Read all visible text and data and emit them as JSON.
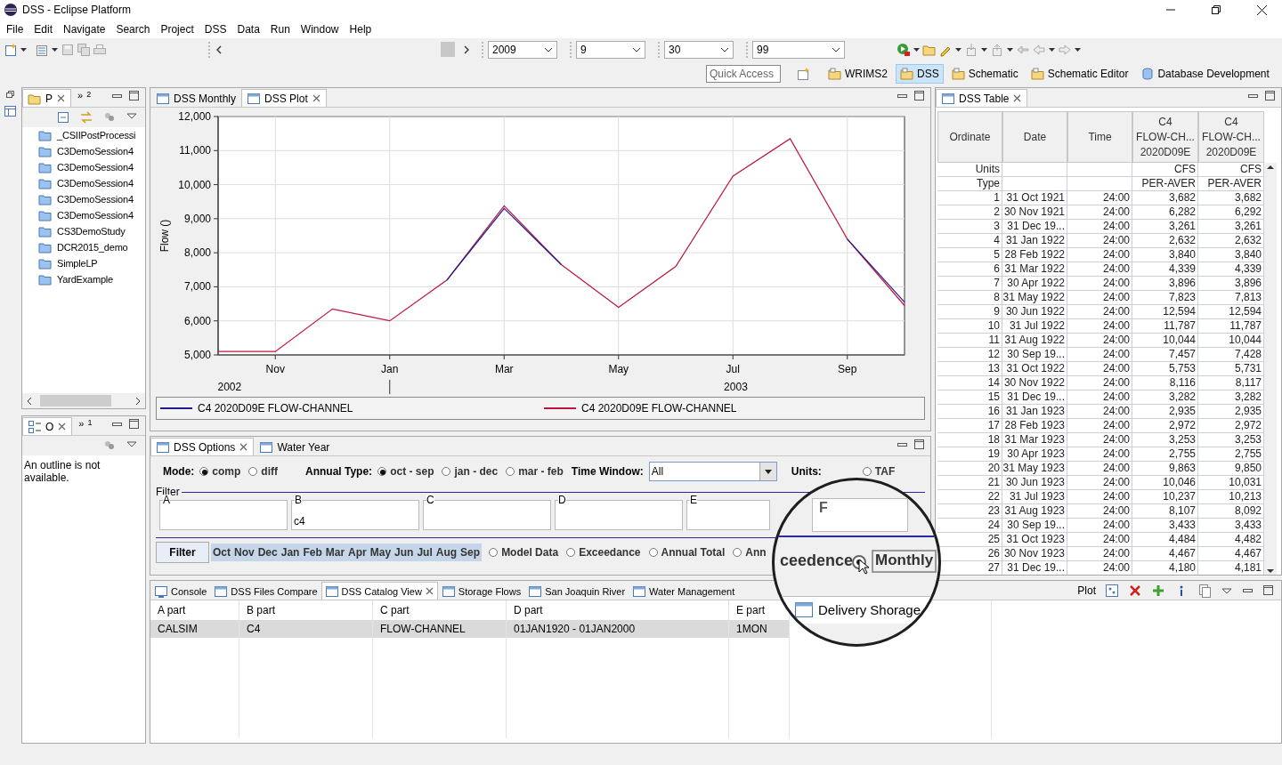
{
  "window": {
    "title": "DSS - Eclipse Platform"
  },
  "menu": [
    "File",
    "Edit",
    "Navigate",
    "Search",
    "Project",
    "DSS",
    "Data",
    "Run",
    "Window",
    "Help"
  ],
  "toolbar": {
    "combos": [
      "2009",
      "9",
      "30",
      "99"
    ]
  },
  "quick_access": {
    "placeholder": "Quick Access"
  },
  "perspectives": [
    {
      "label": "WRIMS2",
      "selected": false,
      "kind": "folder"
    },
    {
      "label": "DSS",
      "selected": true,
      "kind": "folder"
    },
    {
      "label": "Schematic",
      "selected": false,
      "kind": "folder"
    },
    {
      "label": "Schematic Editor",
      "selected": false,
      "kind": "folder"
    },
    {
      "label": "Database Development",
      "selected": false,
      "kind": "database"
    }
  ],
  "project_explorer": {
    "tab": "P",
    "overflow_symbol": "»",
    "overflow_count": "2",
    "items": [
      "_CSIIPostProcessi",
      "C3DemoSession4",
      "C3DemoSession4",
      "C3DemoSession4",
      "C3DemoSession4",
      "C3DemoSession4",
      "CS3DemoStudy",
      "DCR2015_demo",
      "SimpleLP",
      "YardExample"
    ]
  },
  "outline": {
    "tab": "O",
    "overflow_symbol": "»",
    "overflow_count": "1",
    "message": "An outline is not available."
  },
  "editor": {
    "tabs": [
      {
        "label": "DSS Monthly",
        "selected": false
      },
      {
        "label": "DSS Plot",
        "selected": true
      }
    ],
    "plot": {
      "year_labels": [
        "2002",
        "2003"
      ],
      "chart_data": {
        "type": "line",
        "ylabel": "Flow ()",
        "grid": true,
        "categories": [
          null,
          "Nov",
          null,
          "Jan",
          null,
          "Mar",
          null,
          "May",
          null,
          "Jul",
          null,
          "Sep",
          null
        ],
        "ylim": [
          5000,
          12000
        ],
        "yticks": [
          {
            "value": 5000,
            "label": "5,000"
          },
          {
            "value": 6000,
            "label": "6,000"
          },
          {
            "value": 7000,
            "label": "7,000"
          },
          {
            "value": 8000,
            "label": "8,000"
          },
          {
            "value": 9000,
            "label": "9,000"
          },
          {
            "value": 10000,
            "label": "10,000"
          },
          {
            "value": 11000,
            "label": "11,000"
          },
          {
            "value": 12000,
            "label": "12,000"
          }
        ],
        "series": [
          {
            "name": "C4 2020D09E FLOW-CHANNEL",
            "color": "#1c1c8c",
            "values": [
              null,
              null,
              null,
              null,
              7200,
              9300,
              7650,
              null,
              null,
              null,
              null,
              8400,
              6550
            ]
          },
          {
            "name": "C4 2020D09E FLOW-CHANNEL",
            "color": "#c0143c",
            "values": [
              5100,
              5100,
              6350,
              6000,
              7200,
              9380,
              7650,
              6400,
              7600,
              10250,
              11350,
              8400,
              6450
            ]
          }
        ]
      }
    }
  },
  "options": {
    "tabs": [
      {
        "label": "DSS Options",
        "selected": true
      },
      {
        "label": "Water Year",
        "selected": false
      }
    ],
    "mode_label": "Mode:",
    "mode": [
      {
        "label": "comp",
        "selected": true
      },
      {
        "label": "diff",
        "selected": false
      }
    ],
    "annual_type_label": "Annual Type:",
    "annual_type": [
      {
        "label": "oct - sep",
        "selected": true
      },
      {
        "label": "jan - dec",
        "selected": false
      },
      {
        "label": "mar - feb",
        "selected": false
      }
    ],
    "time_window_label": "Time Window:",
    "time_window": "All",
    "units_label": "Units:",
    "units": [
      {
        "label": "TAF",
        "selected": false
      }
    ],
    "filter_title": "Filter",
    "filter_fields": [
      {
        "label": "A"
      },
      {
        "label": "B",
        "value": "c4"
      },
      {
        "label": "C"
      },
      {
        "label": "D"
      },
      {
        "label": "E"
      }
    ],
    "filter_button": "Filter",
    "months": [
      {
        "label": "Oct",
        "selected": true
      },
      {
        "label": "Nov",
        "selected": true
      },
      {
        "label": "Dec",
        "selected": true
      },
      {
        "label": "Jan",
        "selected": true
      },
      {
        "label": "Feb",
        "selected": true
      },
      {
        "label": "Mar",
        "selected": true
      },
      {
        "label": "Apr",
        "selected": true
      },
      {
        "label": "May",
        "selected": true
      },
      {
        "label": "Jun",
        "selected": true
      },
      {
        "label": "Jul",
        "selected": true
      },
      {
        "label": "Aug",
        "selected": true
      },
      {
        "label": "Sep",
        "selected": true
      }
    ],
    "views": [
      {
        "label": "Model Data",
        "selected": false
      },
      {
        "label": "Exceedance",
        "selected": false
      },
      {
        "label": "Annual Total",
        "selected": false
      },
      {
        "label": "Ann",
        "selected": false
      }
    ]
  },
  "magnifier": {
    "field_label": "F",
    "view_text": "ceedence",
    "view_option": {
      "label": "Monthly",
      "selected": true
    },
    "tab": "Delivery Shorage"
  },
  "catalog": {
    "tabs": [
      {
        "label": "Console",
        "selected": false,
        "kind": "console"
      },
      {
        "label": "DSS Files Compare",
        "selected": false,
        "kind": "view"
      },
      {
        "label": "DSS Catalog View",
        "selected": true,
        "kind": "view"
      },
      {
        "label": "Storage Flows",
        "selected": false,
        "kind": "view"
      },
      {
        "label": "San Joaquin River",
        "selected": false,
        "kind": "view"
      },
      {
        "label": "Water Management",
        "selected": false,
        "kind": "view"
      }
    ],
    "toolbar_label": "Plot",
    "columns": [
      "A part",
      "B part",
      "C part",
      "D part",
      "E part"
    ],
    "rows": [
      {
        "cells": [
          "CALSIM",
          "C4",
          "FLOW-CHANNEL",
          "01JAN1920 - 01JAN2000",
          "1MON"
        ],
        "selected": true
      }
    ]
  },
  "dss_table": {
    "tab": {
      "label": "DSS Table",
      "selected": true
    },
    "columns": [
      {
        "lines": [
          "Ordinate"
        ]
      },
      {
        "lines": [
          "Date"
        ]
      },
      {
        "lines": [
          "Time"
        ]
      },
      {
        "lines": [
          "C4",
          "FLOW-CH...",
          "2020D09E"
        ]
      },
      {
        "lines": [
          "C4",
          "FLOW-CH...",
          "2020D09E"
        ]
      }
    ],
    "meta_rows": [
      {
        "label": "Units",
        "values": [
          "CFS",
          "CFS"
        ]
      },
      {
        "label": "Type",
        "values": [
          "PER-AVER",
          "PER-AVER"
        ]
      }
    ],
    "rows": [
      [
        "1",
        "31 Oct 1921",
        "24:00",
        "3,682",
        "3,682"
      ],
      [
        "2",
        "30 Nov 1921",
        "24:00",
        "6,282",
        "6,292"
      ],
      [
        "3",
        "31 Dec 19...",
        "24:00",
        "3,261",
        "3,261"
      ],
      [
        "4",
        "31 Jan 1922",
        "24:00",
        "2,632",
        "2,632"
      ],
      [
        "5",
        "28 Feb 1922",
        "24:00",
        "3,840",
        "3,840"
      ],
      [
        "6",
        "31 Mar 1922",
        "24:00",
        "4,339",
        "4,339"
      ],
      [
        "7",
        "30 Apr 1922",
        "24:00",
        "3,896",
        "3,896"
      ],
      [
        "8",
        "31 May 1922",
        "24:00",
        "7,823",
        "7,813"
      ],
      [
        "9",
        "30 Jun 1922",
        "24:00",
        "12,594",
        "12,594"
      ],
      [
        "10",
        "31 Jul 1922",
        "24:00",
        "11,787",
        "11,787"
      ],
      [
        "11",
        "31 Aug 1922",
        "24:00",
        "10,044",
        "10,044"
      ],
      [
        "12",
        "30 Sep 19...",
        "24:00",
        "7,457",
        "7,428"
      ],
      [
        "13",
        "31 Oct 1922",
        "24:00",
        "5,753",
        "5,731"
      ],
      [
        "14",
        "30 Nov 1922",
        "24:00",
        "8,116",
        "8,117"
      ],
      [
        "15",
        "31 Dec 19...",
        "24:00",
        "3,282",
        "3,282"
      ],
      [
        "16",
        "31 Jan 1923",
        "24:00",
        "2,935",
        "2,935"
      ],
      [
        "17",
        "28 Feb 1923",
        "24:00",
        "2,972",
        "2,972"
      ],
      [
        "18",
        "31 Mar 1923",
        "24:00",
        "3,253",
        "3,253"
      ],
      [
        "19",
        "30 Apr 1923",
        "24:00",
        "2,755",
        "2,755"
      ],
      [
        "20",
        "31 May 1923",
        "24:00",
        "9,863",
        "9,850"
      ],
      [
        "21",
        "30 Jun 1923",
        "24:00",
        "10,046",
        "10,031"
      ],
      [
        "22",
        "31 Jul 1923",
        "24:00",
        "10,237",
        "10,213"
      ],
      [
        "23",
        "31 Aug 1923",
        "24:00",
        "8,107",
        "8,092"
      ],
      [
        "24",
        "30 Sep 19...",
        "24:00",
        "3,433",
        "3,433"
      ],
      [
        "25",
        "31 Oct 1923",
        "24:00",
        "4,484",
        "4,482"
      ],
      [
        "26",
        "30 Nov 1923",
        "24:00",
        "4,467",
        "4,467"
      ],
      [
        "27",
        "31 Dec 19...",
        "24:00",
        "4,180",
        "4,181"
      ]
    ]
  }
}
